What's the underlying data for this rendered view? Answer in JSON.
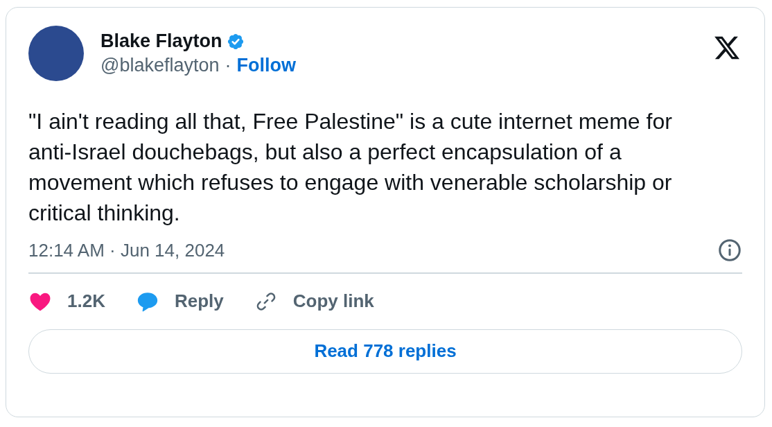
{
  "author": {
    "name": "Blake Flayton",
    "verified": true,
    "handle": "@blakeflayton",
    "separator": "·",
    "follow": "Follow"
  },
  "text": "\"I ain't reading all that, Free Palestine\" is a cute internet meme for anti-Israel douchebags, but also a perfect encapsulation of a movement which refuses to engage with venerable scholarship or critical thinking.",
  "timestamp": "12:14 AM · Jun 14, 2024",
  "actions": [
    {
      "kind": "like",
      "label": "1.2K"
    },
    {
      "kind": "reply",
      "label": "Reply"
    },
    {
      "kind": "copy",
      "label": "Copy link"
    }
  ],
  "read_replies": "Read 778 replies"
}
